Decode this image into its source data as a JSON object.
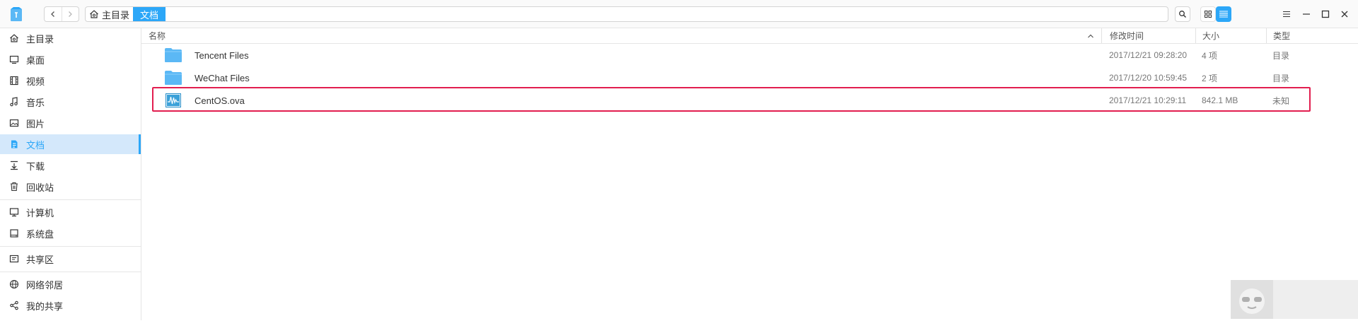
{
  "toolbar": {
    "back_icon": "chevron-left",
    "forward_icon": "chevron-right",
    "breadcrumb": [
      {
        "label": "主目录",
        "icon": "home-icon"
      },
      {
        "label": "文档"
      }
    ],
    "search_icon": "magnifier",
    "view_modes": [
      "icon-view",
      "list-view"
    ],
    "active_view": "list-view",
    "window_controls": [
      "menu",
      "minimize",
      "maximize",
      "close"
    ]
  },
  "sidebar": {
    "items": [
      {
        "label": "主目录",
        "icon": "home-icon"
      },
      {
        "label": "桌面",
        "icon": "desktop-icon"
      },
      {
        "label": "视频",
        "icon": "video-icon"
      },
      {
        "label": "音乐",
        "icon": "music-icon"
      },
      {
        "label": "图片",
        "icon": "picture-icon"
      },
      {
        "label": "文档",
        "icon": "document-icon",
        "selected": true
      },
      {
        "label": "下载",
        "icon": "download-icon"
      },
      {
        "label": "回收站",
        "icon": "trash-icon"
      },
      {
        "label": "计算机",
        "icon": "computer-icon"
      },
      {
        "label": "系统盘",
        "icon": "disk-icon"
      },
      {
        "label": "共享区",
        "icon": "share-area-icon"
      },
      {
        "label": "网络邻居",
        "icon": "network-icon"
      },
      {
        "label": "我的共享",
        "icon": "my-share-icon"
      }
    ]
  },
  "file_list": {
    "columns": [
      "名称",
      "修改时间",
      "大小",
      "类型"
    ],
    "sort_indicator": "ascending",
    "rows": [
      {
        "name": "Tencent Files",
        "modified": "2017/12/21 09:28:20",
        "size": "4 项",
        "type": "目录",
        "icon": "folder-icon"
      },
      {
        "name": "WeChat Files",
        "modified": "2017/12/20 10:59:45",
        "size": "2 项",
        "type": "目录",
        "icon": "folder-icon"
      },
      {
        "name": "CentOS.ova",
        "modified": "2017/12/21 10:29:11",
        "size": "842.1 MB",
        "type": "未知",
        "icon": "ova-file-icon",
        "highlighted": true
      }
    ]
  },
  "colors": {
    "accent": "#2ca7f8",
    "selection_bg": "#d4e8fb",
    "highlight_border": "#e21e4f",
    "folder": "#5bb8f5"
  }
}
